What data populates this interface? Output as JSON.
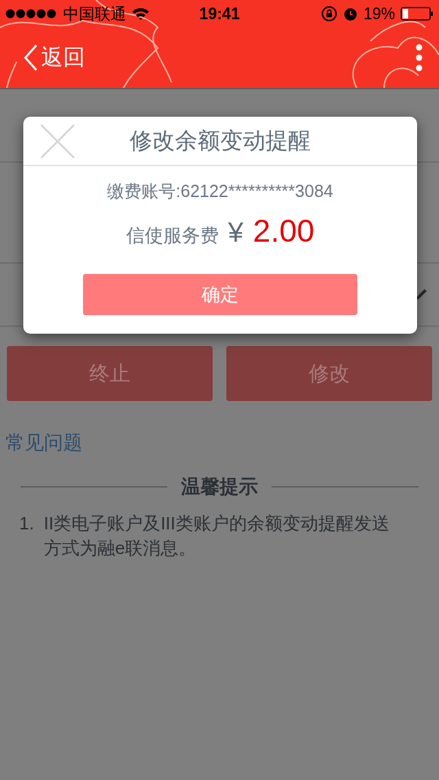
{
  "status_bar": {
    "carrier": "中国联通",
    "time": "19:41",
    "battery": "19%"
  },
  "nav": {
    "back": "返回"
  },
  "rows": [
    {
      "kind": "text"
    },
    {
      "kind": "text"
    },
    {
      "kind": "editable"
    }
  ],
  "buttons": [
    {
      "label": "终止"
    },
    {
      "label": "修改"
    }
  ],
  "faq_link": "常见问题",
  "tips": {
    "title": "温馨提示",
    "items": [
      {
        "number": "1.",
        "text": "II类电子账户及III类账户的余额变动提醒发送方式为融e联消息。"
      }
    ]
  },
  "dialog": {
    "title": "修改余额变动提醒",
    "account": "缴费账号:62122**********3084",
    "fee_label": "信使服务费",
    "currency": "¥",
    "amount": "2.00",
    "confirm": "确定"
  }
}
